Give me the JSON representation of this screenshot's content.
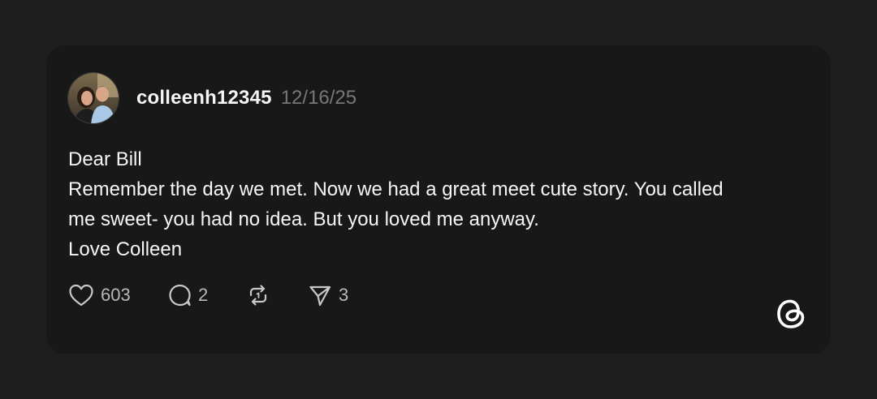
{
  "post": {
    "username": "colleenh12345",
    "timestamp": "12/16/25",
    "lines": [
      "Dear Bill",
      "Remember the day we met. Now we had a great meet cute story. You called",
      "me sweet- you had no idea. But you loved me anyway.",
      "Love Colleen"
    ]
  },
  "actions": {
    "likes": "603",
    "replies": "2",
    "shares": "3"
  },
  "icons": {
    "like": "heart-icon",
    "reply": "speech-bubble-icon",
    "repost": "repost-icon",
    "share": "send-icon",
    "brand": "threads-logo-icon"
  },
  "colors": {
    "background": "#1e1e1e",
    "card": "#181818",
    "text": "#f3f5f7",
    "muted": "#777777"
  }
}
